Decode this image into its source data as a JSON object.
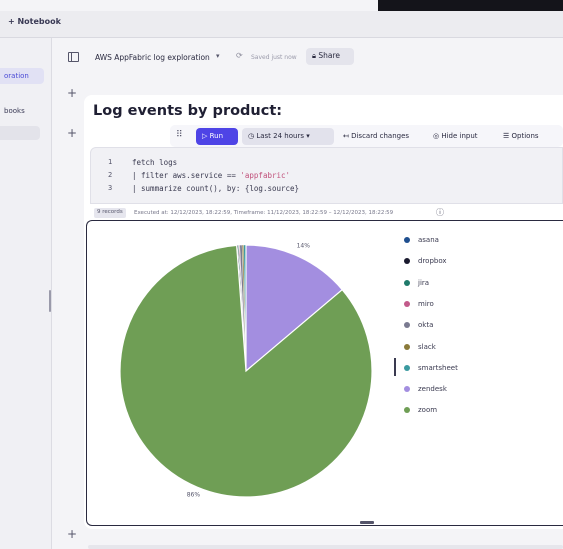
{
  "topbar": {
    "new_notebook": "+ Notebook"
  },
  "nav": {
    "item1": "oration",
    "item2": "books",
    "item3": ""
  },
  "header": {
    "notebook_title": "AWS AppFabric log exploration",
    "chevron": "▾",
    "save_status": "Saved just now",
    "share_label": "Share"
  },
  "section": {
    "title": "Log events by product:",
    "run_label": "Run",
    "timeframe_label": "Last 24 hours",
    "discard_label": "Discard changes",
    "hide_input_label": "Hide input",
    "options_label": "Options"
  },
  "code": {
    "line_numbers": [
      "1",
      "2",
      "3"
    ],
    "line1": "fetch logs",
    "line2_pre": "| filter aws.service == ",
    "line2_str": "'appfabric'",
    "line3": "| summarize count(), by: {log.source}"
  },
  "result": {
    "records_badge": "9 records",
    "meta": "Executed at: 12/12/2023, 18:22:59, Timeframe: 11/12/2023, 18:22:59 – 12/12/2023, 18:22:59"
  },
  "chart_data": {
    "type": "pie",
    "categories": [
      "asana",
      "dropbox",
      "jira",
      "miro",
      "okta",
      "slack",
      "smartsheet",
      "zendesk",
      "zoom"
    ],
    "values": [
      0.1,
      0.1,
      0.1,
      0.1,
      0.3,
      0.2,
      0.3,
      14,
      86
    ],
    "slice_labels": [
      "",
      "",
      "",
      "",
      "",
      "",
      "",
      "14%",
      "86%"
    ],
    "colors": [
      "#1f4f8f",
      "#1a1a2e",
      "#1f7a6a",
      "#c25a8a",
      "#7a7a90",
      "#8a7a3a",
      "#3a9aa0",
      "#a38ee0",
      "#6f9e55"
    ],
    "legend_position": "right"
  }
}
